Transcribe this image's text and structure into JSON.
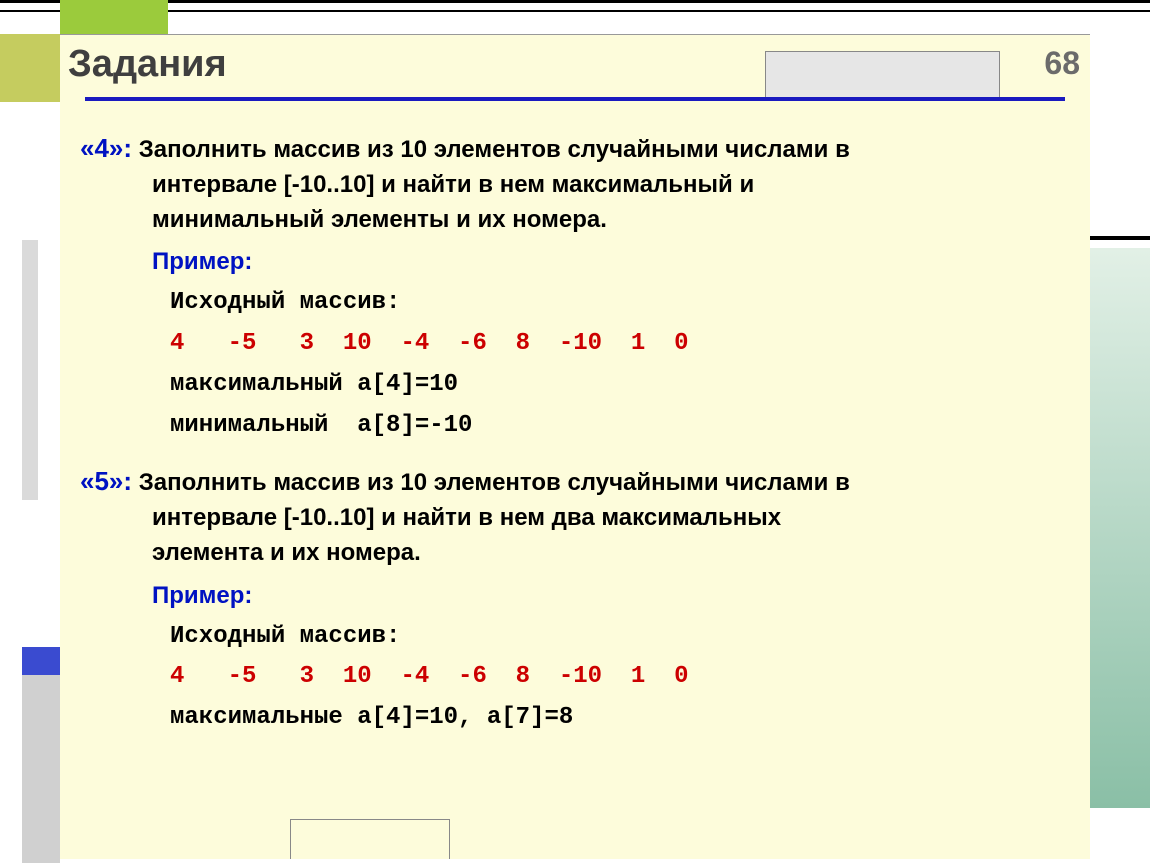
{
  "pageNumber": "68",
  "title": "Задания",
  "task4": {
    "label": "«4»:",
    "text_line1": "Заполнить  массив из 10 элементов случайными числами в",
    "text_line2": "интервале [-10..10] и найти в нем максимальный и",
    "text_line3": "минимальный элементы и их номера.",
    "example_label": "Пример:",
    "src_label": "Исходный массив:",
    "array": "4   -5   3  10  -4  -6  8  -10  1  0",
    "max": "максимальный a[4]=10",
    "min": "минимальный  a[8]=-10"
  },
  "task5": {
    "label": "«5»:",
    "text_line1": "Заполнить  массив из 10 элементов случайными числами в",
    "text_line2": "интервале [-10..10] и найти в нем два максимальных",
    "text_line3": "элемента и их номера.",
    "example_label": "Пример:",
    "src_label": "Исходный массив:",
    "array": "4   -5   3  10  -4  -6  8  -10  1  0",
    "max": "максимальные a[4]=10, a[7]=8"
  }
}
